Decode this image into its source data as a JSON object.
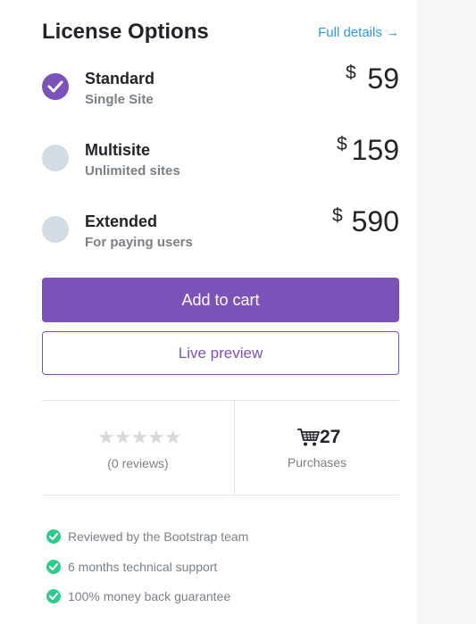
{
  "header": {
    "title": "License Options",
    "details_link": "Full details →"
  },
  "options": [
    {
      "name": "Standard",
      "subtitle": "Single Site",
      "currency": "$",
      "price": "59",
      "selected": true
    },
    {
      "name": "Multisite",
      "subtitle": "Unlimited sites",
      "currency": "$",
      "price": "159",
      "selected": false
    },
    {
      "name": "Extended",
      "subtitle": "For paying users",
      "currency": "$",
      "price": "590",
      "selected": false
    }
  ],
  "actions": {
    "add_to_cart": "Add to cart",
    "live_preview": "Live preview"
  },
  "stats": {
    "stars": "★★★★★",
    "rating_value": 0,
    "reviews": "(0 reviews)",
    "purchase_count": "27",
    "purchase_label": "Purchases"
  },
  "features": [
    "Reviewed by the Bootstrap team",
    "6 months technical support",
    "100% money back guarantee"
  ],
  "colors": {
    "accent": "#7a52b8",
    "link": "#2d9cdb",
    "check": "#2fcb8a",
    "radio_unselected": "#d3dbe3"
  },
  "icons": {
    "checked_radio": "checkmark-icon",
    "cart": "shopping-cart-icon",
    "feature_check": "check-circle-icon"
  }
}
